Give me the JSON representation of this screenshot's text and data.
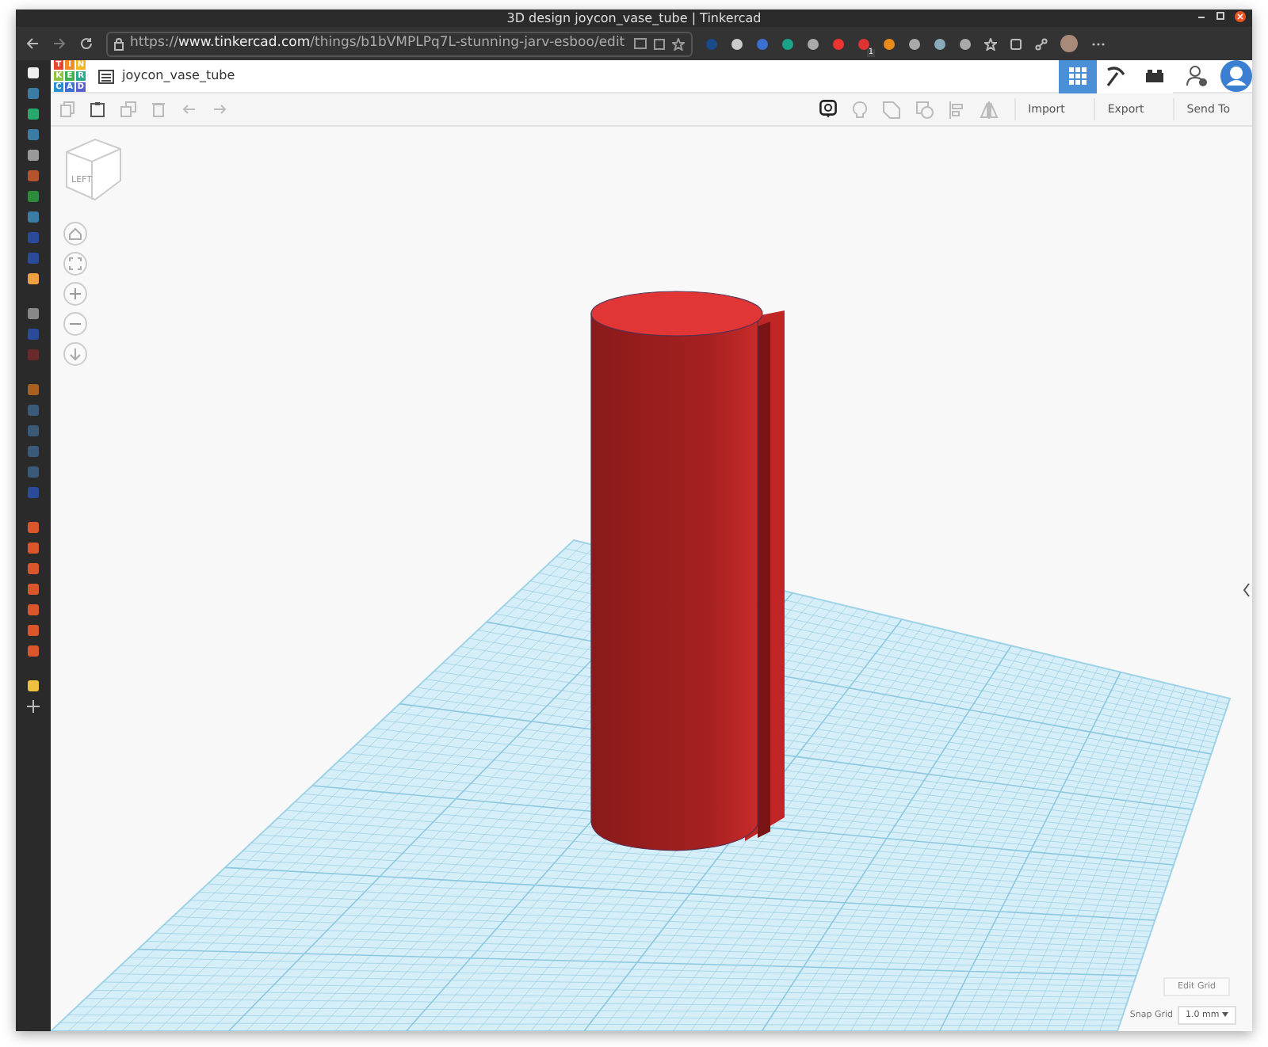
{
  "window": {
    "title": "3D design joycon_vase_tube | Tinkercad"
  },
  "browser": {
    "url": "https://**www.tinkercad.com**/things/b1bVMPLPq7L-stunning-jarv-esboo/edit",
    "extension_badge": "1"
  },
  "app": {
    "logo": [
      {
        "text": "T",
        "color": "#e8462f"
      },
      {
        "text": "I",
        "color": "#f28c28"
      },
      {
        "text": "N",
        "color": "#f5b51c"
      },
      {
        "text": "K",
        "color": "#8fc440"
      },
      {
        "text": "E",
        "color": "#3fb04c"
      },
      {
        "text": "R",
        "color": "#2aa98b"
      },
      {
        "text": "C",
        "color": "#2a8fd1"
      },
      {
        "text": "A",
        "color": "#3b6fd1"
      },
      {
        "text": "D",
        "color": "#5a5fd0"
      }
    ],
    "design_name": "joycon_vase_tube",
    "views": [
      {
        "kind": "grid",
        "selected": true
      },
      {
        "kind": "pickaxe",
        "selected": false
      },
      {
        "kind": "bricks",
        "selected": false
      }
    ],
    "actions": [
      "Import",
      "Export",
      "Send To"
    ],
    "view_cube": {
      "face": "LEFT"
    },
    "edit_grid": "Edit Grid",
    "snap_grid_label": "Snap Grid",
    "snap_grid_value": "1.0 mm"
  }
}
